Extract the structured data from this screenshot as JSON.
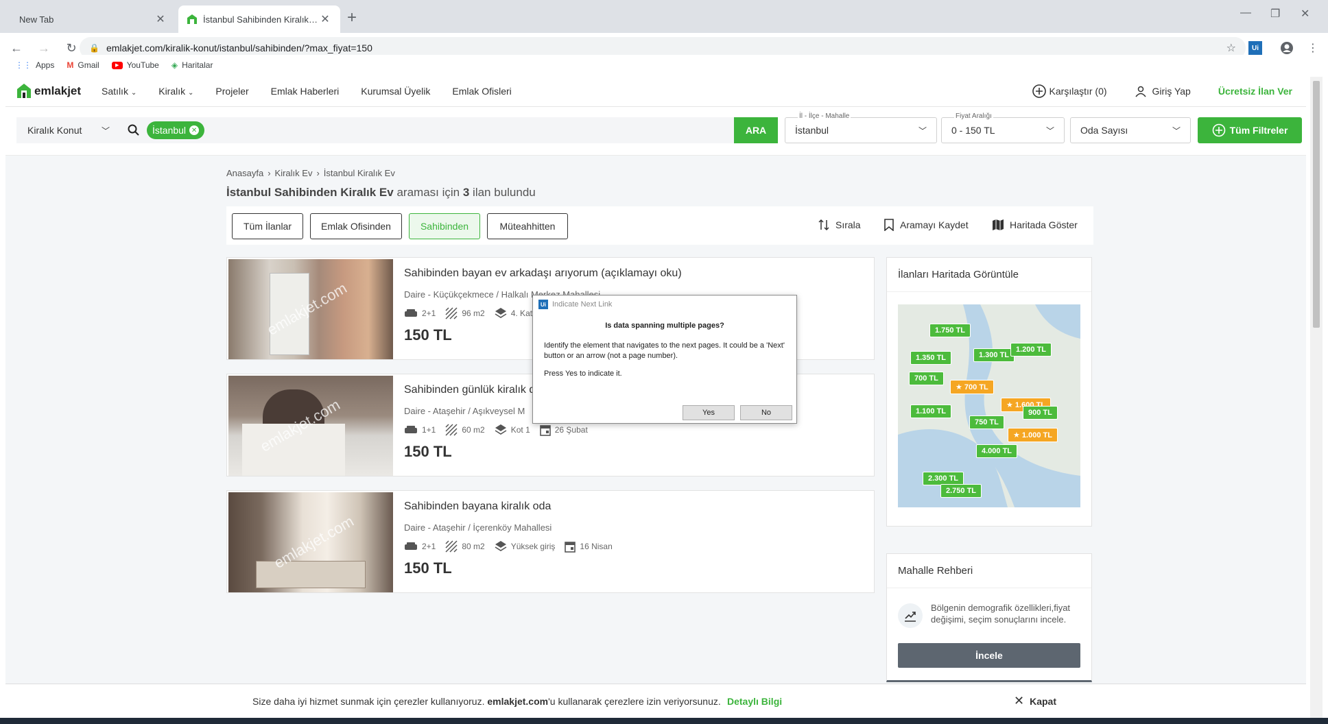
{
  "browser": {
    "tabs": [
      {
        "title": "New Tab",
        "active": false
      },
      {
        "title": "İstanbul Sahibinden Kiralık Ev - E",
        "active": true
      }
    ],
    "url": "emlakjet.com/kiralik-konut/istanbul/sahibinden/?max_fiyat=150",
    "bookmarks": [
      "Apps",
      "Gmail",
      "YouTube",
      "Haritalar"
    ]
  },
  "header": {
    "logo": "emlakjet",
    "nav": [
      "Satılık",
      "Kiralık",
      "Projeler",
      "Emlak Haberleri",
      "Kurumsal Üyelik",
      "Emlak Ofisleri"
    ],
    "compare": "Karşılaştır (0)",
    "login": "Giriş Yap",
    "free_listing": "Ücretsiz İlan Ver"
  },
  "search": {
    "category": "Kiralık Konut",
    "chip": "İstanbul",
    "button": "ARA",
    "location_label": "İl - İlçe - Mahalle",
    "location_value": "İstanbul",
    "price_label": "Fiyat Aralığı",
    "price_value": "0 - 150 TL",
    "rooms": "Oda Sayısı",
    "all_filters": "Tüm Filtreler"
  },
  "breadcrumb": [
    "Anasayfa",
    "Kiralık Ev",
    "İstanbul Kiralık Ev"
  ],
  "result": {
    "query": "İstanbul Sahibinden Kiralık Ev",
    "mid": "araması için",
    "count": "3",
    "suffix": "ilan bulundu"
  },
  "filters": {
    "buttons": [
      "Tüm İlanlar",
      "Emlak Ofisinden",
      "Sahibinden",
      "Müteahhitten"
    ],
    "selected": "Sahibinden",
    "sort": "Sırala",
    "save": "Aramayı Kaydet",
    "map": "Haritada Göster"
  },
  "listings": [
    {
      "title": "Sahibinden bayan ev arkadaşı arıyorum (açıklamayı oku)",
      "location": "Daire - Küçükçekmece / Halkalı Merkez Mahallesi",
      "rooms": "2+1",
      "area": "96 m2",
      "floor": "4. Kat",
      "date": "",
      "price": "150 TL",
      "watermark": "emlakjet.com"
    },
    {
      "title": "Sahibinden günlük kiralık d",
      "location": "Daire - Ataşehir / Aşıkveysel M",
      "rooms": "1+1",
      "area": "60 m2",
      "floor": "Kot 1",
      "date": "26 Şubat",
      "price": "150 TL",
      "watermark": "emlakjet.com"
    },
    {
      "title": "Sahibinden bayana kiralık oda",
      "location": "Daire - Ataşehir / İçerenköy Mahallesi",
      "rooms": "2+1",
      "area": "80 m2",
      "floor": "Yüksek giriş",
      "date": "16 Nisan",
      "price": "150 TL",
      "watermark": "emlakjet.com"
    }
  ],
  "sidebar": {
    "map_title": "İlanları Haritada Görüntüle",
    "pins": [
      {
        "label": "1.750 TL",
        "color": "green"
      },
      {
        "label": "1.350 TL",
        "color": "green"
      },
      {
        "label": "1.300 TL",
        "color": "green"
      },
      {
        "label": "1.200 TL",
        "color": "green"
      },
      {
        "label": "700 TL",
        "color": "green"
      },
      {
        "label": "★ 700 TL",
        "color": "orange"
      },
      {
        "label": "★ 1.600 TL",
        "color": "orange"
      },
      {
        "label": "1.100 TL",
        "color": "green"
      },
      {
        "label": "900 TL",
        "color": "green"
      },
      {
        "label": "750 TL",
        "color": "green"
      },
      {
        "label": "★ 1.000 TL",
        "color": "orange"
      },
      {
        "label": "4.000 TL",
        "color": "green"
      },
      {
        "label": "2.300 TL",
        "color": "green"
      },
      {
        "label": "2.750 TL",
        "color": "green"
      }
    ],
    "rehber_title": "Mahalle Rehberi",
    "rehber_text": "Bölgenin demografik özellikleri,fiyat değişimi, seçim sonuçlarını incele.",
    "rehber_button": "İncele"
  },
  "cookie": {
    "text_before": "Size daha iyi hizmet sunmak için çerezler kullanıyoruz.",
    "brand": "emlakjet.com",
    "text_after": "'u kullanarak çerezlere izin veriyorsunuz.",
    "link": "Detaylı Bilgi",
    "close": "Kapat"
  },
  "dialog": {
    "title": "Indicate Next Link",
    "logo": "Ui",
    "question": "Is data spanning multiple pages?",
    "body": "Identify the element that navigates to the next pages. It could be a 'Next' button or an arrow (not a page number).",
    "press": "Press Yes to indicate it.",
    "yes": "Yes",
    "no": "No"
  },
  "colors": {
    "brand_green": "#3cb43c",
    "pin_orange": "#f5a623"
  }
}
